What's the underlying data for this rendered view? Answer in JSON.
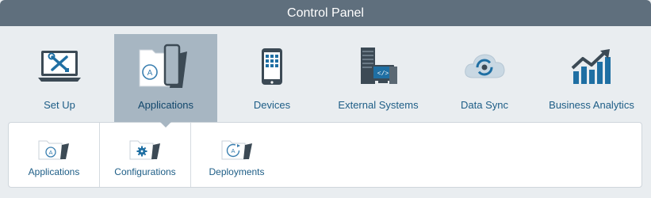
{
  "window": {
    "title": "Control Panel"
  },
  "nav": {
    "items": [
      {
        "label": "Set Up",
        "icon": "laptop-tools-icon"
      },
      {
        "label": "Applications",
        "icon": "folder-phone-icon",
        "active": true
      },
      {
        "label": "Devices",
        "icon": "smartphone-icon"
      },
      {
        "label": "External Systems",
        "icon": "server-monitor-icon"
      },
      {
        "label": "Data Sync",
        "icon": "cloud-sync-icon"
      },
      {
        "label": "Business Analytics",
        "icon": "chart-growth-icon"
      }
    ]
  },
  "subnav": {
    "items": [
      {
        "label": "Applications",
        "icon": "app-folder-icon"
      },
      {
        "label": "Configurations",
        "icon": "config-folder-icon"
      },
      {
        "label": "Deployments",
        "icon": "deploy-folder-icon"
      }
    ]
  },
  "colors": {
    "titlebar": "#5f6f7d",
    "active_tab": "#a7b6c2",
    "label": "#1d5d86",
    "background": "#e9edf0"
  }
}
